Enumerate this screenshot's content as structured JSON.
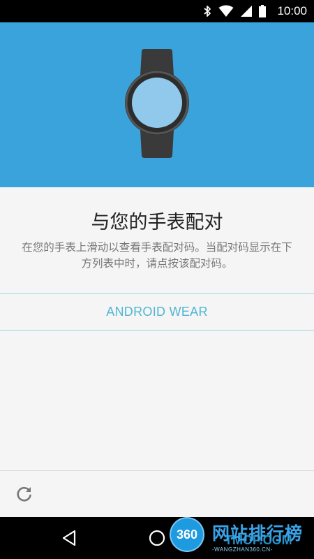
{
  "status_bar": {
    "time": "10:00",
    "icons": [
      "bluetooth-icon",
      "wifi-icon",
      "cell-signal-icon",
      "battery-icon"
    ]
  },
  "hero": {
    "illustration": "smartwatch-icon",
    "color": "#3aa3db"
  },
  "content": {
    "title": "与您的手表配对",
    "subtitle": "在您的手表上滑动以查看手表配对码。当配对码显示在下方列表中时，请点按该配对码。"
  },
  "devices": [
    {
      "label": "ANDROID WEAR"
    }
  ],
  "footer": {
    "refresh_icon": "refresh-icon"
  },
  "nav_bar": {
    "icons": [
      "back-icon",
      "home-icon",
      "recents-icon"
    ]
  },
  "watermark": {
    "logo_text": "360",
    "name": "网站排行榜",
    "site": "TMOP.COM",
    "url": "-WANGZHAN360.CN-"
  },
  "colors": {
    "accent": "#4fb6d4",
    "hero": "#3aa3db",
    "divider": "#9fd3e8"
  }
}
